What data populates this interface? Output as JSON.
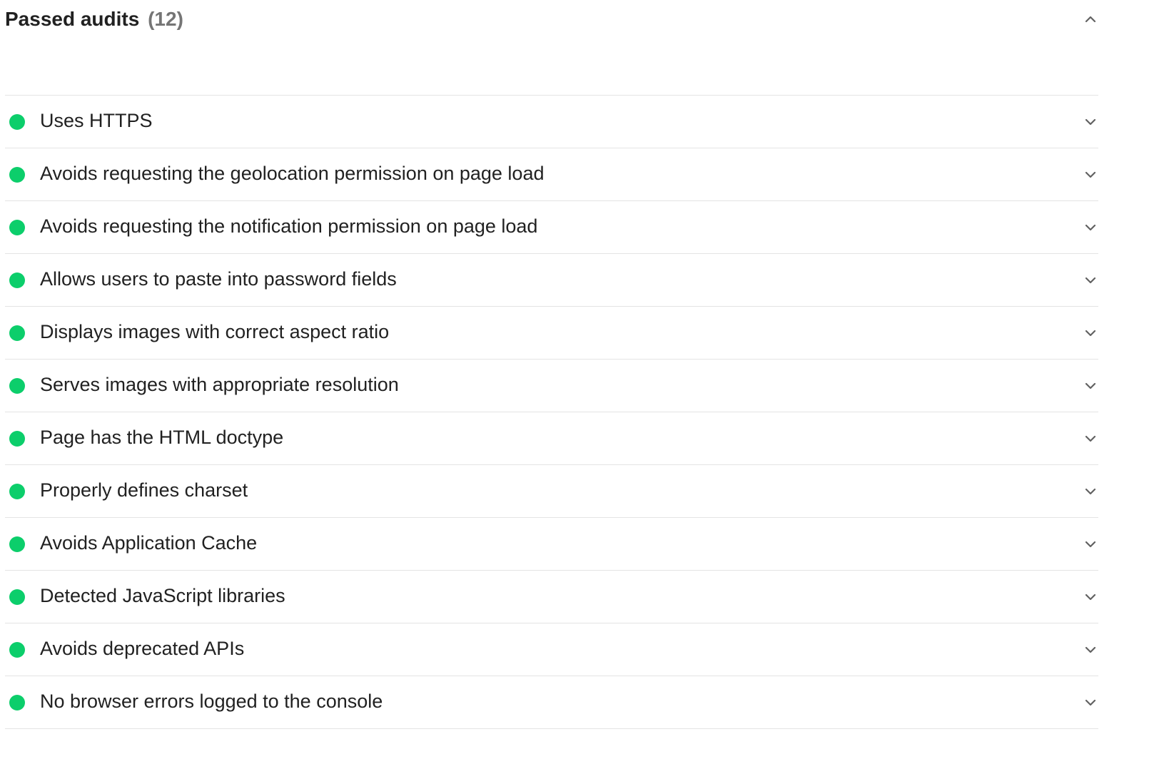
{
  "group": {
    "title": "Passed audits",
    "count": "(12)",
    "expanded": true,
    "status_color": "#0cce6b"
  },
  "audits": [
    {
      "title": "Uses HTTPS"
    },
    {
      "title": "Avoids requesting the geolocation permission on page load"
    },
    {
      "title": "Avoids requesting the notification permission on page load"
    },
    {
      "title": "Allows users to paste into password fields"
    },
    {
      "title": "Displays images with correct aspect ratio"
    },
    {
      "title": "Serves images with appropriate resolution"
    },
    {
      "title": "Page has the HTML doctype"
    },
    {
      "title": "Properly defines charset"
    },
    {
      "title": "Avoids Application Cache"
    },
    {
      "title": "Detected JavaScript libraries"
    },
    {
      "title": "Avoids deprecated APIs"
    },
    {
      "title": "No browser errors logged to the console"
    }
  ]
}
